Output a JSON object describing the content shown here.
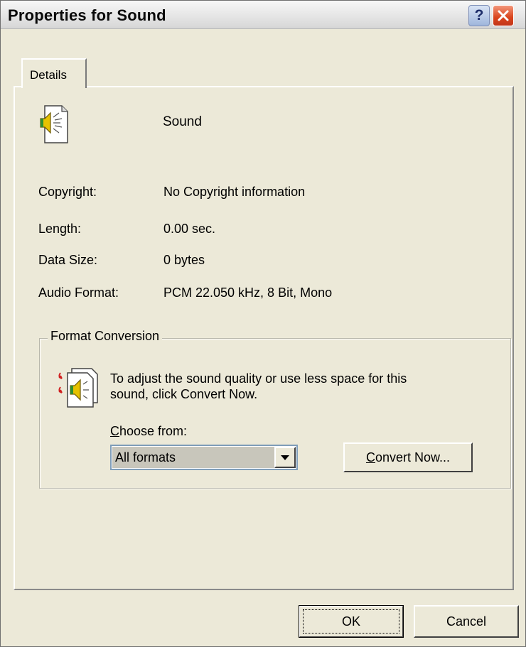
{
  "window": {
    "title": "Properties for Sound"
  },
  "tabs": [
    {
      "label": "Details"
    }
  ],
  "file": {
    "name": "Sound",
    "icon": "sound-file-icon"
  },
  "properties": [
    {
      "label": "Copyright:",
      "value": "No Copyright information"
    },
    {
      "label": "Length:",
      "value": "0.00 sec."
    },
    {
      "label": "Data Size:",
      "value": "0 bytes"
    },
    {
      "label": "Audio Format:",
      "value": "PCM 22.050 kHz, 8 Bit, Mono"
    }
  ],
  "conversion": {
    "legend": "Format Conversion",
    "description": "To adjust the sound quality or use less space for this sound, click Convert Now.",
    "choose_label_accel": "C",
    "choose_label_rest": "hoose from:",
    "selected_format": "All formats",
    "convert_accel": "C",
    "convert_rest": "onvert Now..."
  },
  "buttons": {
    "ok": "OK",
    "cancel": "Cancel"
  },
  "colors": {
    "face": "#ece9d8",
    "close": "#d9441c",
    "select_highlight": "#c8c6bb"
  }
}
